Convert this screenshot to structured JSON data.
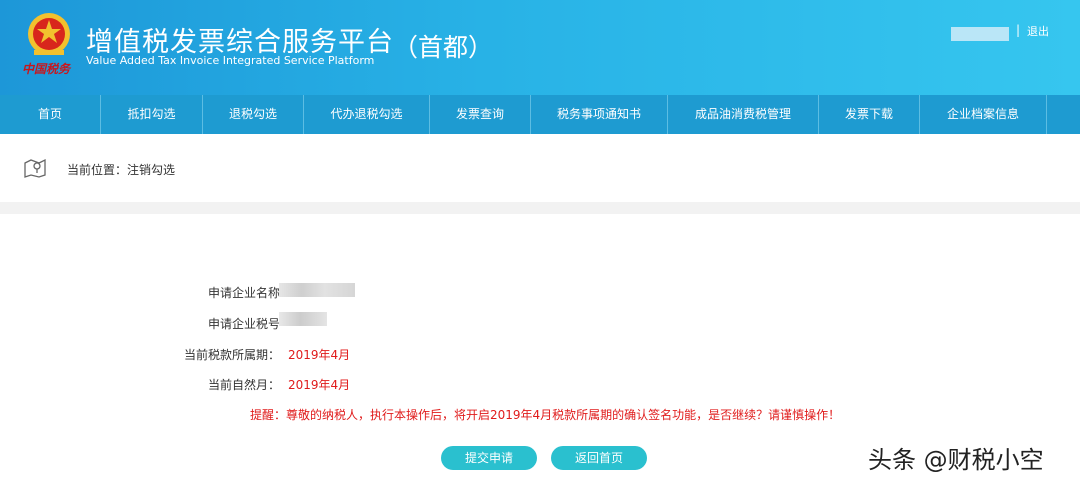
{
  "header": {
    "emblem_text": "中国税务",
    "title_cn": "增值税发票综合服务平台",
    "title_en": "Value Added Tax Invoice Integrated Service Platform",
    "region": "（首都）",
    "separator": "|",
    "logout": "退出"
  },
  "nav": {
    "items": [
      {
        "label": "首页"
      },
      {
        "label": "抵扣勾选"
      },
      {
        "label": "退税勾选"
      },
      {
        "label": "代办退税勾选"
      },
      {
        "label": "发票查询"
      },
      {
        "label": "税务事项通知书"
      },
      {
        "label": "成品油消费税管理"
      },
      {
        "label": "发票下载"
      },
      {
        "label": "企业档案信息"
      }
    ]
  },
  "breadcrumb": {
    "label": "当前位置：注销勾选"
  },
  "form": {
    "company_name_label": "申请企业名称",
    "company_tax_id_label": "申请企业税号",
    "tax_period_label": "当前税款所属期：",
    "tax_period_value": "2019年4月",
    "natural_month_label": "当前自然月：",
    "natural_month_value": "2019年4月",
    "warning": "提醒：尊敬的纳税人，执行本操作后，将开启2019年4月税款所属期的确认签名功能，是否继续？请谨慎操作！"
  },
  "buttons": {
    "submit": "提交申请",
    "back": "返回首页"
  },
  "watermark": "头条 @财税小空",
  "colors": {
    "header_start": "#1d97d8",
    "header_end": "#36c6ef",
    "nav_bg": "#1e9bd1",
    "button_bg": "#2ac0cf",
    "warning_red": "#e01b1b"
  }
}
